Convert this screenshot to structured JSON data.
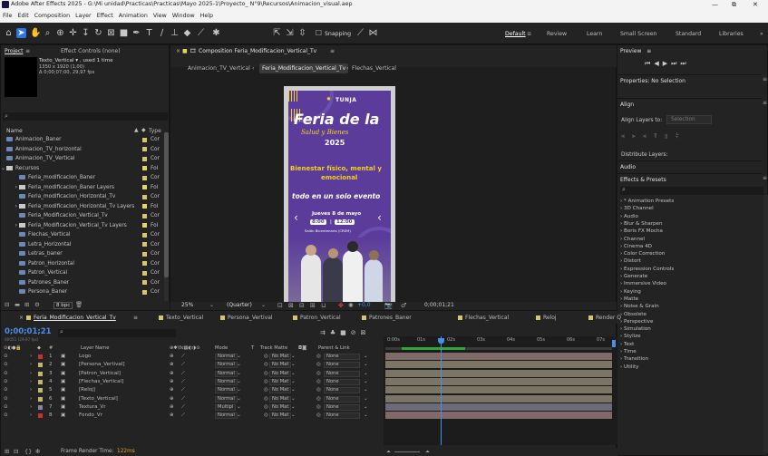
{
  "window": {
    "title": "Adobe After Effects 2025 - G:\\Mi unidad\\Practicas\\Practicas\\Mayo 2025-1\\Proyecto_ N°9\\Recursos\\Animacion_visual.aep",
    "minimize": "—",
    "maximize": "⧉",
    "close": "✕"
  },
  "menu": [
    "File",
    "Edit",
    "Composition",
    "Layer",
    "Effect",
    "Animation",
    "View",
    "Window",
    "Help"
  ],
  "toolbar": {
    "snapping_label": "Snapping",
    "workspaces": [
      "Default",
      "Review",
      "Learn",
      "Small Screen",
      "Standard",
      "Libraries"
    ],
    "more": "»"
  },
  "project": {
    "tab_project": "Project",
    "tab_effect_controls": "Effect Controls (none)",
    "thumb_title": "Texto_Vertical ▾ , used 1 time",
    "thumb_size": "1350 x 1920 (1,00)",
    "thumb_duration": "Δ 0;00;07;00, 29,97 fps",
    "col_name": "Name",
    "col_type": "Type",
    "items": [
      {
        "name": "Animacion_Baner",
        "type": "Cor",
        "kind": "comp",
        "indent": 0,
        "color": "#d4c66f"
      },
      {
        "name": "Animacion_TV_horizontal",
        "type": "Cor",
        "kind": "comp",
        "indent": 0,
        "color": "#d4c66f"
      },
      {
        "name": "Animacion_TV_Vertical",
        "type": "Cor",
        "kind": "comp",
        "indent": 0,
        "color": "#d4c66f"
      },
      {
        "name": "Recursos",
        "type": "Fol",
        "kind": "folder",
        "indent": 0,
        "color": "#e3d85a",
        "open": true
      },
      {
        "name": "Feria_modificacion_Baner",
        "type": "Cor",
        "kind": "comp",
        "indent": 1,
        "color": "#d4c66f"
      },
      {
        "name": "Feria_modificacion_Baner Layers",
        "type": "Fol",
        "kind": "folder",
        "indent": 1,
        "color": "#e3d85a"
      },
      {
        "name": "Feria_modificacion_Horizontal_Tv",
        "type": "Cor",
        "kind": "comp",
        "indent": 1,
        "color": "#d4c66f"
      },
      {
        "name": "Feria_modificacion_Horizontal_Tv Layers",
        "type": "Fol",
        "kind": "folder",
        "indent": 1,
        "color": "#e3d85a"
      },
      {
        "name": "Feria_Modificacion_Vertical_Tv",
        "type": "Cor",
        "kind": "comp",
        "indent": 1,
        "color": "#d4c66f"
      },
      {
        "name": "Feria_Modificacion_Vertical_Tv Layers",
        "type": "Fol",
        "kind": "folder",
        "indent": 1,
        "color": "#e3d85a"
      },
      {
        "name": "Flechas_Vertical",
        "type": "Cor",
        "kind": "comp",
        "indent": 1,
        "color": "#d4c66f"
      },
      {
        "name": "Letra_Horizontal",
        "type": "Cor",
        "kind": "comp",
        "indent": 1,
        "color": "#d4c66f"
      },
      {
        "name": "Letras_baner",
        "type": "Cor",
        "kind": "comp",
        "indent": 1,
        "color": "#d4c66f"
      },
      {
        "name": "Patron_Horizontal",
        "type": "Cor",
        "kind": "comp",
        "indent": 1,
        "color": "#d4c66f"
      },
      {
        "name": "Patron_Vertical",
        "type": "Cor",
        "kind": "comp",
        "indent": 1,
        "color": "#d4c66f"
      },
      {
        "name": "Patrones_Baner",
        "type": "Cor",
        "kind": "comp",
        "indent": 1,
        "color": "#d4c66f"
      },
      {
        "name": "Persona_Baner",
        "type": "Cor",
        "kind": "comp",
        "indent": 1,
        "color": "#d4c66f"
      }
    ],
    "bpc": "8 bpc"
  },
  "composition": {
    "tab_label": "Composition Feria_Modificacion_Vertical_Tv",
    "breadcrumbs": [
      "Animacion_TV_Vertical",
      "Feria_Modificacion_Vertical_Tv",
      "Flechas_Vertical"
    ],
    "zoom": "25%",
    "resolution": "(Quarter)",
    "exposure": "+0,0",
    "timecode": "0;00;01;21"
  },
  "poster": {
    "brand": "TUNJA",
    "title_line1": "Feria de la",
    "title_line2": "Salud y Bienes",
    "year": "2025",
    "slogan_line1": "Bienestar físico, mental y",
    "slogan_line2": "emocional",
    "slogan2": "todo en un solo evento",
    "date": "Jueves 8 de mayo",
    "time_start": "8:00",
    "time_end": "12:00",
    "venue": "Salón Bicentenario (CREM)"
  },
  "timeline": {
    "tabs": [
      "Feria_Modificacion_Vertical_Tv",
      "Texto_Vertical",
      "Persona_Vertival",
      "Patron_Vertical",
      "Patrones_Baner",
      "Flechas_Vertical",
      "Reloj",
      "Render Q"
    ],
    "tab_colors": [
      "#d4c66f",
      "#d4c66f",
      "#d4c66f",
      "#d4c66f",
      "#d4c66f",
      "#d4c66f",
      "#d4c66f",
      "#d4c66f"
    ],
    "timecode": "0;00;01;21",
    "fps": "00051 (29,97 fps)",
    "col_num": "#",
    "col_layer": "Layer Name",
    "col_mode": "Mode",
    "col_t": "T",
    "col_track": "Track Matte",
    "col_parent": "Parent & Link",
    "ruler": [
      "0:00s",
      "01s",
      "02s",
      "03s",
      "04s",
      "05s",
      "06s",
      "07s"
    ],
    "layers": [
      {
        "num": "1",
        "name": "Logo",
        "mode": "Normal",
        "track": "No Mat",
        "parent": "None",
        "color": "#c5332f",
        "bar": "#806a67"
      },
      {
        "num": "2",
        "name": "[Persona_Vertival]",
        "mode": "Normal",
        "track": "No Mat",
        "parent": "None",
        "color": "#c3b76b",
        "bar": "#7b7565"
      },
      {
        "num": "3",
        "name": "[Patron_Vertical]",
        "mode": "Normal",
        "track": "No Mat",
        "parent": "None",
        "color": "#c3b76b",
        "bar": "#7b7565"
      },
      {
        "num": "4",
        "name": "[Flechas_Vertical]",
        "mode": "Normal",
        "track": "No Mat",
        "parent": "None",
        "color": "#c3b76b",
        "bar": "#7b7565"
      },
      {
        "num": "5",
        "name": "[Reloj]",
        "mode": "Normal",
        "track": "No Mat",
        "parent": "None",
        "color": "#c3b76b",
        "bar": "#7b7565"
      },
      {
        "num": "6",
        "name": "[Texto_Vertical]",
        "mode": "Normal",
        "track": "No Mat",
        "parent": "None",
        "color": "#c3b76b",
        "bar": "#7b7565"
      },
      {
        "num": "7",
        "name": "Textura_Vr",
        "mode": "Multipl",
        "track": "No Mat",
        "parent": "None",
        "color": "#8a7fa8",
        "bar": "#6e6a7a"
      },
      {
        "num": "8",
        "name": "Fondo_Vr",
        "mode": "Normal",
        "track": "No Mat",
        "parent": "None",
        "color": "#c5332f",
        "bar": "#806a67"
      }
    ],
    "frame_render": "Frame Render Time:",
    "frame_render_value": "122ms"
  },
  "right": {
    "preview": "Preview",
    "properties": "Properties: No Selection",
    "align": "Align",
    "align_to": "Align Layers to:",
    "align_to_value": "Selection",
    "distribute": "Distribute Layers:",
    "audio": "Audio",
    "effects": "Effects & Presets",
    "fx_items": [
      "* Animation Presets",
      "3D Channel",
      "Audio",
      "Blur & Sharpen",
      "Boris FX Mocha",
      "Channel",
      "Cinema 4D",
      "Color Correction",
      "Distort",
      "Expression Controls",
      "Generate",
      "Immersive Video",
      "Keying",
      "Matte",
      "Noise & Grain",
      "Obsolete",
      "Perspective",
      "Simulation",
      "Stylize",
      "Text",
      "Time",
      "Transition",
      "Utility"
    ]
  },
  "colors": {
    "accent": "#2d75e8",
    "poster_bg": "#5b3c9b",
    "poster_yellow": "#f2d21c"
  }
}
